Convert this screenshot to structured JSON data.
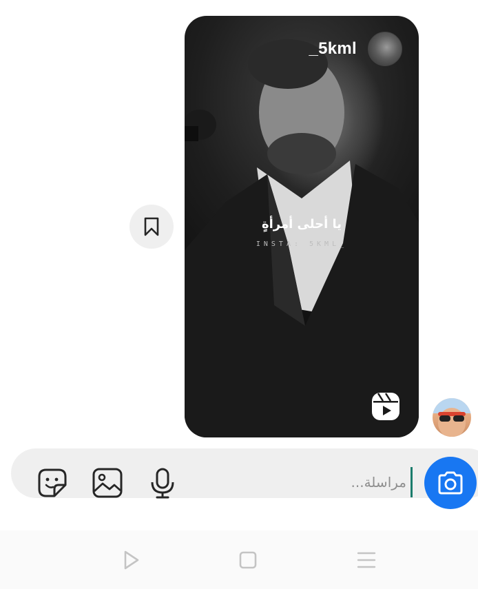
{
  "reel": {
    "username": "_5kml",
    "caption": "يا أحلى أمرأةٍ",
    "watermark": "INSTA: 5KML_"
  },
  "icons": {
    "save": "bookmark-icon",
    "reels": "reels-icon",
    "sticker": "sticker-icon",
    "gallery": "gallery-icon",
    "mic": "microphone-icon",
    "camera": "camera-icon",
    "nav_back": "back-icon",
    "nav_home": "home-icon",
    "nav_recents": "recents-icon"
  },
  "composer": {
    "placeholder": "مراسلة..."
  },
  "colors": {
    "camera_button": "#1877f2",
    "composer_bg": "#efefef",
    "cursor": "#1b7c6c"
  }
}
